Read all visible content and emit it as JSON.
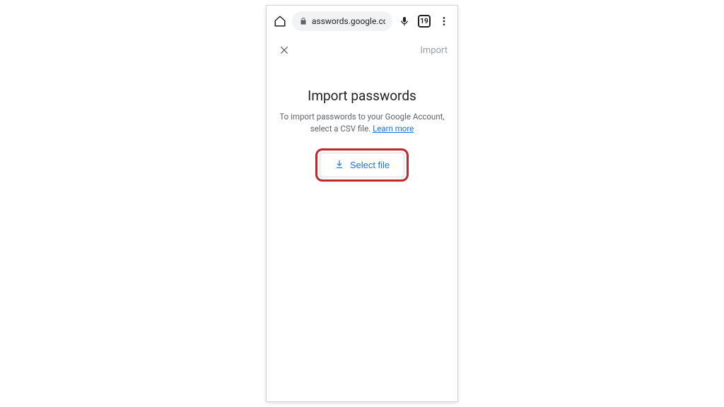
{
  "browser": {
    "url": "asswords.google.com",
    "tab_count": "19"
  },
  "header": {
    "action_label": "Import"
  },
  "content": {
    "title": "Import passwords",
    "description_prefix": "To import passwords to your Google Account, select a CSV file. ",
    "learn_more": "Learn more",
    "select_file_label": "Select file"
  }
}
